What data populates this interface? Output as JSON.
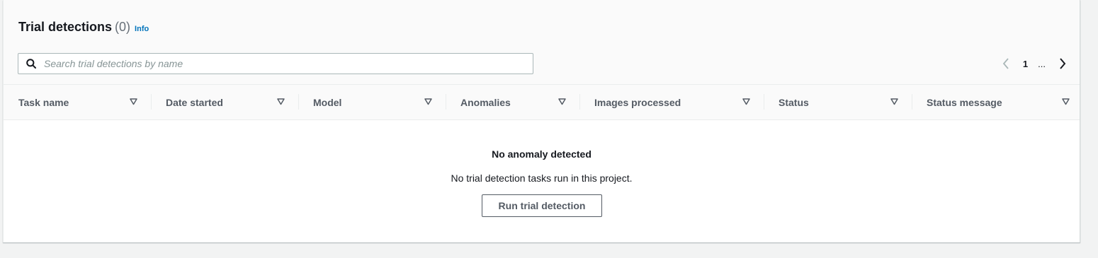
{
  "header": {
    "title": "Trial detections",
    "count": "(0)",
    "info_link": "Info"
  },
  "search": {
    "placeholder": "Search trial detections by name",
    "value": ""
  },
  "pagination": {
    "current_page": "1",
    "ellipsis": "..."
  },
  "table": {
    "columns": [
      {
        "label": "Task name"
      },
      {
        "label": "Date started"
      },
      {
        "label": "Model"
      },
      {
        "label": "Anomalies"
      },
      {
        "label": "Images processed"
      },
      {
        "label": "Status"
      },
      {
        "label": "Status message"
      }
    ],
    "rows": []
  },
  "empty_state": {
    "title": "No anomaly detected",
    "description": "No trial detection tasks run in this project.",
    "action_label": "Run trial detection"
  },
  "colors": {
    "link": "#0073bb",
    "header_bg": "#fafafa",
    "page_bg": "#f2f3f3",
    "text": "#16191f",
    "muted": "#545b64"
  },
  "icons": {
    "search": "search-icon",
    "prev": "chevron-left-icon",
    "next": "chevron-right-icon",
    "sort": "caret-down-icon"
  }
}
